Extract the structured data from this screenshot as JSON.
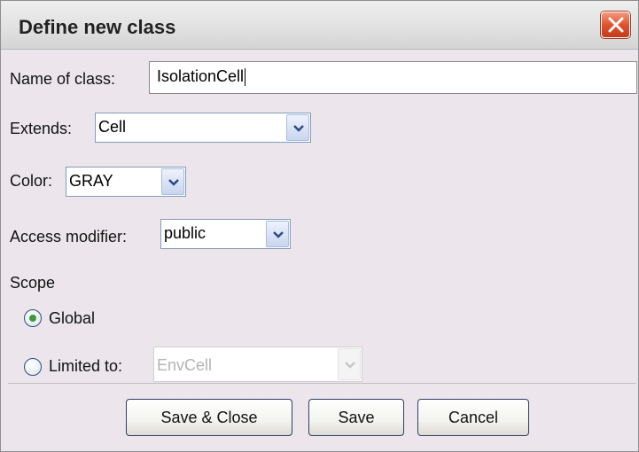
{
  "dialog": {
    "title": "Define new class",
    "close_icon": "close-x-icon"
  },
  "form": {
    "name_label": "Name of class:",
    "name_value": "IsolationCell",
    "extends_label": "Extends:",
    "extends_value": "Cell",
    "color_label": "Color:",
    "color_value": "GRAY",
    "access_label": "Access modifier:",
    "access_value": "public",
    "scope_label": "Scope",
    "scope_global_label": "Global",
    "scope_global_selected": true,
    "scope_limited_label": "Limited to:",
    "scope_limited_value": "EnvCell",
    "scope_limited_enabled": false
  },
  "buttons": {
    "save_close": "Save & Close",
    "save": "Save",
    "cancel": "Cancel"
  },
  "colors": {
    "close_button": "#e0532e",
    "dialog_background": "#ece6ec",
    "radio_selected": "#3a9a3a"
  }
}
